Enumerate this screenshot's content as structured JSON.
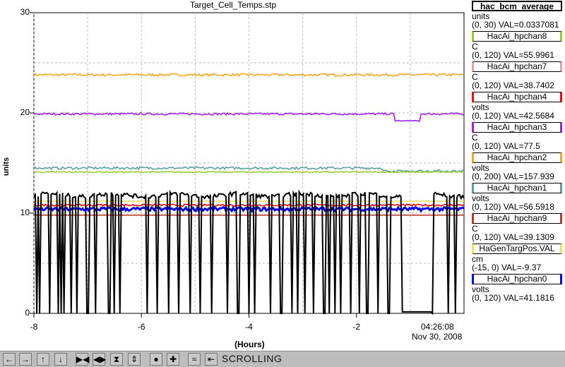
{
  "title": "Target_Cell_Temps.stp",
  "ylabel": "units",
  "xlabel": "(Hours)",
  "timestamp": {
    "time": "04:26:08",
    "date": "Nov 30, 2008"
  },
  "scrolling_label": "SCROLLING",
  "legend": [
    {
      "name": "hac_bcm_average",
      "unit": "units",
      "range": "(0, 30) VAL=0.0337081",
      "color": "#000000",
      "header": true
    },
    {
      "name": "HacAi_hpchan8",
      "unit": "C",
      "range": "(0, 120) VAL=55.9961",
      "color": "#9acd32"
    },
    {
      "name": "HacAi_hpchan7",
      "unit": "C",
      "range": "(0, 120) VAL=38.7402",
      "color": "#e8a0a0"
    },
    {
      "name": "HacAi_hpchan4",
      "unit": "volts",
      "range": "(0, 120) VAL=42.5684",
      "color": "#ff0000"
    },
    {
      "name": "HacAi_hpchan3",
      "unit": "C",
      "range": "(0, 120) VAL=77.5",
      "color": "#a020f0"
    },
    {
      "name": "HacAi_hpchan2",
      "unit": "volts",
      "range": "(0, 200) VAL=157.939",
      "color": "#f5a623"
    },
    {
      "name": "HacAi_hpchan1",
      "unit": "volts",
      "range": "(0, 120) VAL=56.5918",
      "color": "#5f9ea0"
    },
    {
      "name": "HacAi_hpchan9",
      "unit": "C",
      "range": "(0, 120) VAL=39.1309",
      "color": "#c0392b"
    },
    {
      "name": "HaGenTargPos.VAL",
      "unit": "cm",
      "range": "(-15, 0) VAL=-9.37",
      "color": "#f0e060"
    },
    {
      "name": "HacAi_hpchan0",
      "unit": "volts",
      "range": "(0, 120) VAL=41.1816",
      "color": "#0000ff"
    }
  ],
  "toolbar_icons": [
    "arrow-left-icon",
    "arrow-right-icon",
    "arrow-up-icon",
    "arrow-down-icon",
    "compress-horizontal-icon",
    "expand-horizontal-icon",
    "compress-vertical-icon",
    "expand-vertical-icon",
    "record-icon",
    "add-icon",
    "autoscale-icon",
    "jump-start-icon"
  ],
  "toolbar_glyphs": [
    "←",
    "→",
    "↑",
    "↓",
    "▶◀",
    "◀▶",
    "⧗",
    "⇕",
    "●",
    "✚",
    "≈",
    "⇤"
  ],
  "chart_data": {
    "type": "line",
    "xlim": [
      -8,
      0
    ],
    "ylim": [
      0,
      30
    ],
    "xticks": [
      -8,
      -6,
      -4,
      -2
    ],
    "yticks": [
      0,
      10,
      20,
      30
    ],
    "grid": true,
    "series": [
      {
        "name": "HacAi_hpchan2",
        "color": "#f5a623",
        "base": 23.8,
        "noise": 0.12
      },
      {
        "name": "HacAi_hpchan3",
        "color": "#a020f0",
        "base": 19.9,
        "noise": 0.1,
        "dip": {
          "from": -1.3,
          "to": -0.8,
          "value": 19.2
        }
      },
      {
        "name": "HacAi_hpchan1",
        "color": "#5f9ea0",
        "base": 14.5,
        "noise": 0.12,
        "step": {
          "at": -1.5,
          "value": 14.2
        }
      },
      {
        "name": "HacAi_hpchan8",
        "color": "#9acd32",
        "base": 14.1,
        "noise": 0.06
      },
      {
        "name": "HacAi_hpchan4",
        "color": "#ff0000",
        "base": 10.8,
        "noise": 0.1
      },
      {
        "name": "HacAi_hpchan0",
        "color": "#0000ff",
        "base": 10.4,
        "noise": 0.18
      },
      {
        "name": "HacAi_hpchan9",
        "color": "#c0392b",
        "base": 9.8,
        "noise": 0.0
      },
      {
        "name": "HaGenTargPos.VAL",
        "color": "#f0e060",
        "base": 11.2,
        "noise": 0.0
      },
      {
        "name": "hac_bcm_average",
        "color": "#000000",
        "base": 11.8,
        "noise": 0.2,
        "trips": true
      }
    ]
  }
}
